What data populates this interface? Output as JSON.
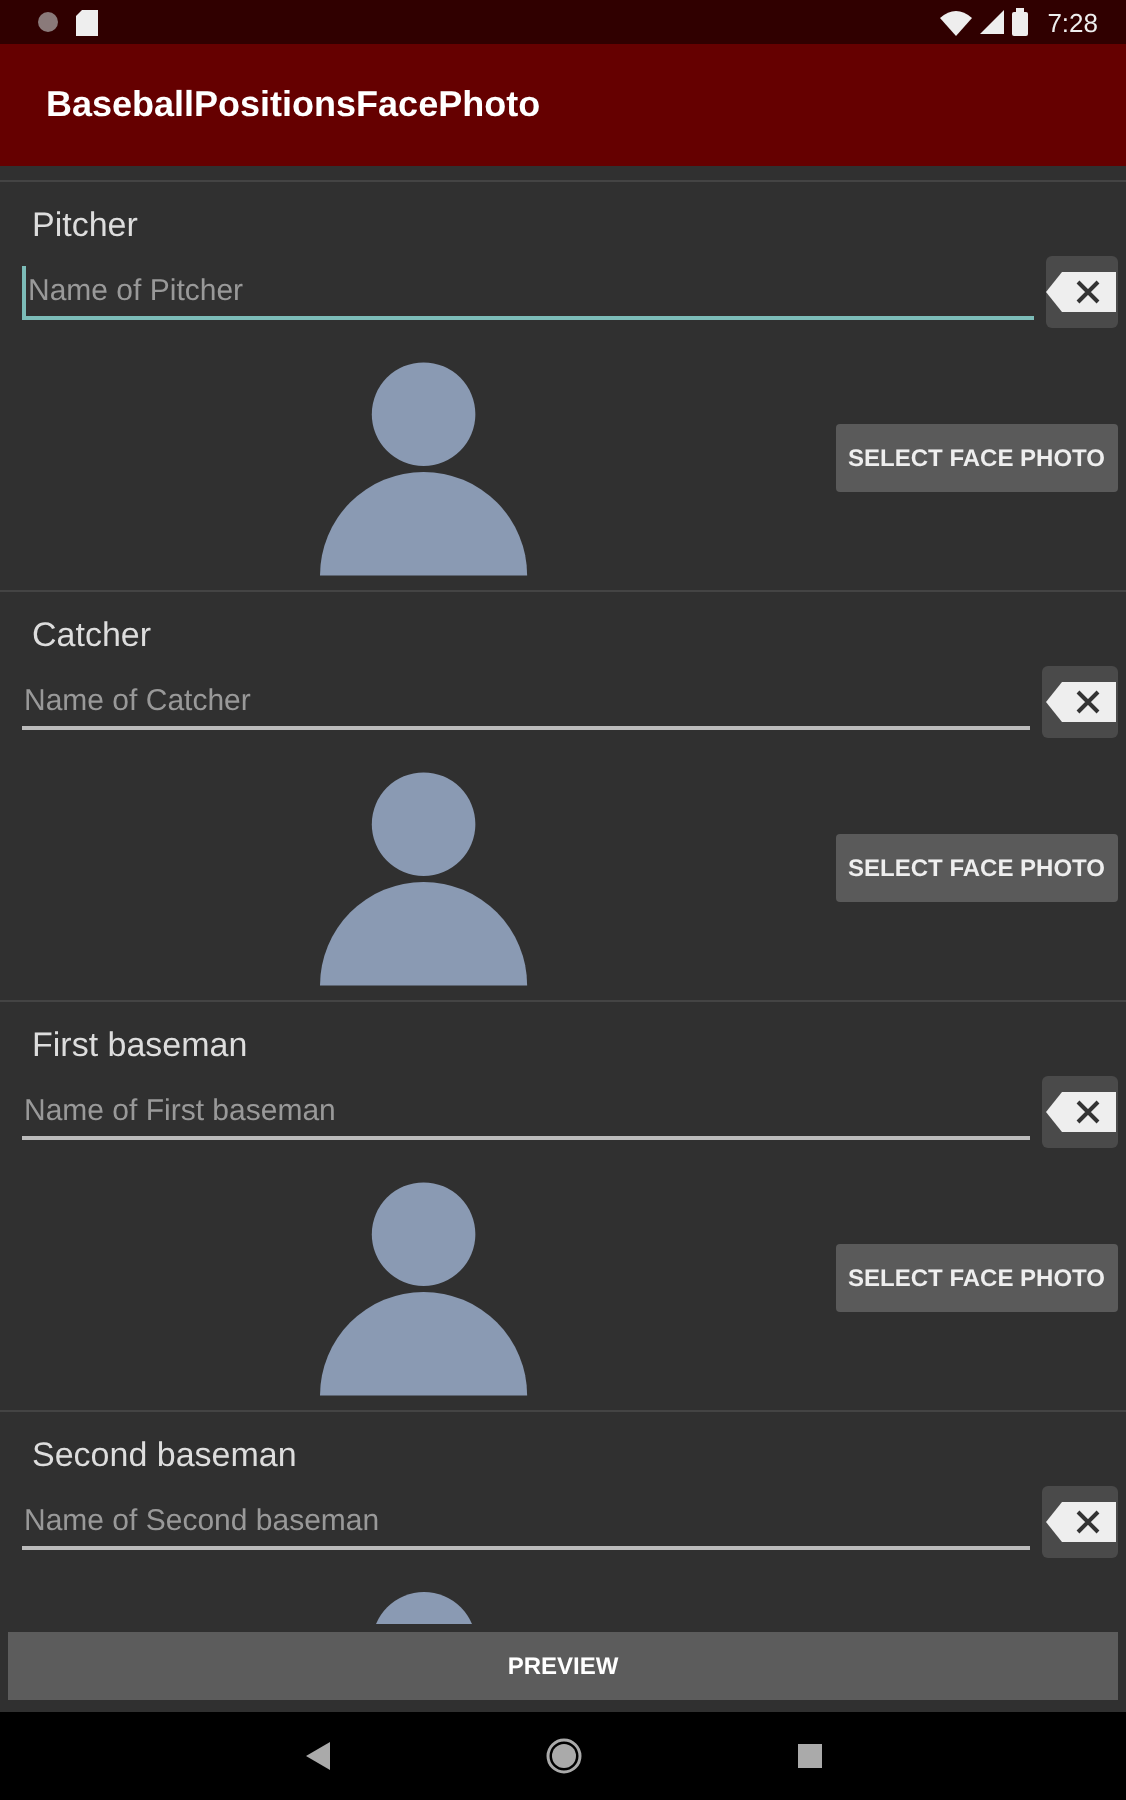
{
  "status_bar": {
    "time": "7:28"
  },
  "app_bar": {
    "title": "BaseballPositionsFacePhoto"
  },
  "positions": [
    {
      "label": "Pitcher",
      "placeholder": "Name of Pitcher",
      "focused": true,
      "button": "SELECT FACE PHOTO"
    },
    {
      "label": "Catcher",
      "placeholder": "Name of Catcher",
      "focused": false,
      "button": "SELECT FACE PHOTO"
    },
    {
      "label": "First baseman",
      "placeholder": "Name of First baseman",
      "focused": false,
      "button": "SELECT FACE PHOTO"
    },
    {
      "label": "Second baseman",
      "placeholder": "Name of Second baseman",
      "focused": false
    }
  ],
  "preview_button": "PREVIEW"
}
